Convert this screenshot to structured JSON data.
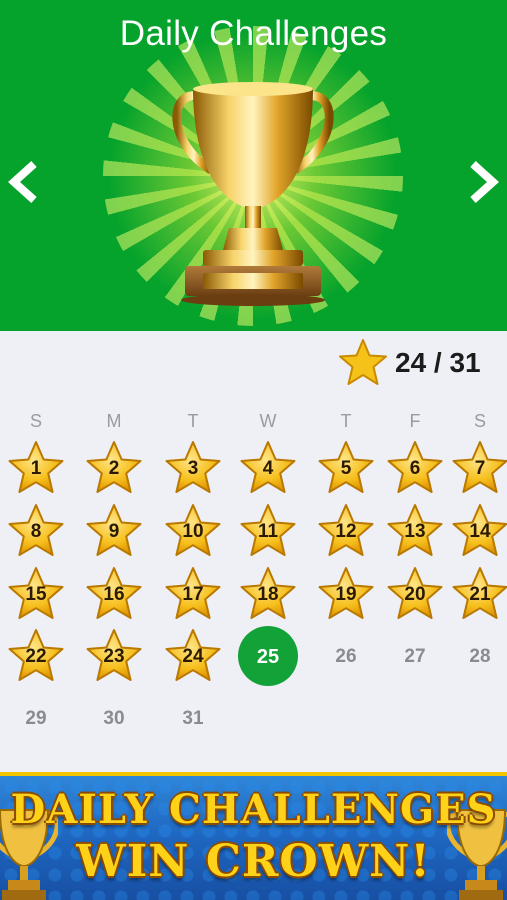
{
  "header": {
    "title": "Daily Challenges",
    "prev_icon": "chevron-left-icon",
    "next_icon": "chevron-right-icon",
    "trophy_icon": "trophy-icon",
    "background_color": "#06a32c"
  },
  "score": {
    "text": "24 / 31",
    "completed": 24,
    "total": 31,
    "icon": "star-icon"
  },
  "weekdays": [
    "S",
    "M",
    "T",
    "W",
    "T",
    "F",
    "S"
  ],
  "calendar": {
    "today": 25,
    "days": [
      {
        "label": "1",
        "state": "completed"
      },
      {
        "label": "2",
        "state": "completed"
      },
      {
        "label": "3",
        "state": "completed"
      },
      {
        "label": "4",
        "state": "completed"
      },
      {
        "label": "5",
        "state": "completed"
      },
      {
        "label": "6",
        "state": "completed"
      },
      {
        "label": "7",
        "state": "completed"
      },
      {
        "label": "8",
        "state": "completed"
      },
      {
        "label": "9",
        "state": "completed"
      },
      {
        "label": "10",
        "state": "completed"
      },
      {
        "label": "11",
        "state": "completed"
      },
      {
        "label": "12",
        "state": "completed"
      },
      {
        "label": "13",
        "state": "completed"
      },
      {
        "label": "14",
        "state": "completed"
      },
      {
        "label": "15",
        "state": "completed"
      },
      {
        "label": "16",
        "state": "completed"
      },
      {
        "label": "17",
        "state": "completed"
      },
      {
        "label": "18",
        "state": "completed"
      },
      {
        "label": "19",
        "state": "completed"
      },
      {
        "label": "20",
        "state": "completed"
      },
      {
        "label": "21",
        "state": "completed"
      },
      {
        "label": "22",
        "state": "completed"
      },
      {
        "label": "23",
        "state": "completed"
      },
      {
        "label": "24",
        "state": "completed"
      },
      {
        "label": "25",
        "state": "today"
      },
      {
        "label": "26",
        "state": "upcoming"
      },
      {
        "label": "27",
        "state": "upcoming"
      },
      {
        "label": "28",
        "state": "upcoming"
      },
      {
        "label": "29",
        "state": "upcoming"
      },
      {
        "label": "30",
        "state": "upcoming"
      },
      {
        "label": "31",
        "state": "upcoming"
      }
    ],
    "colors": {
      "today": "#13a238",
      "star": "#f5c21a",
      "upcoming_text": "#8a8b90"
    }
  },
  "banner": {
    "line1": "DAILY CHALLENGES",
    "line2": "WIN CROWN!",
    "icon": "trophy-icon"
  }
}
